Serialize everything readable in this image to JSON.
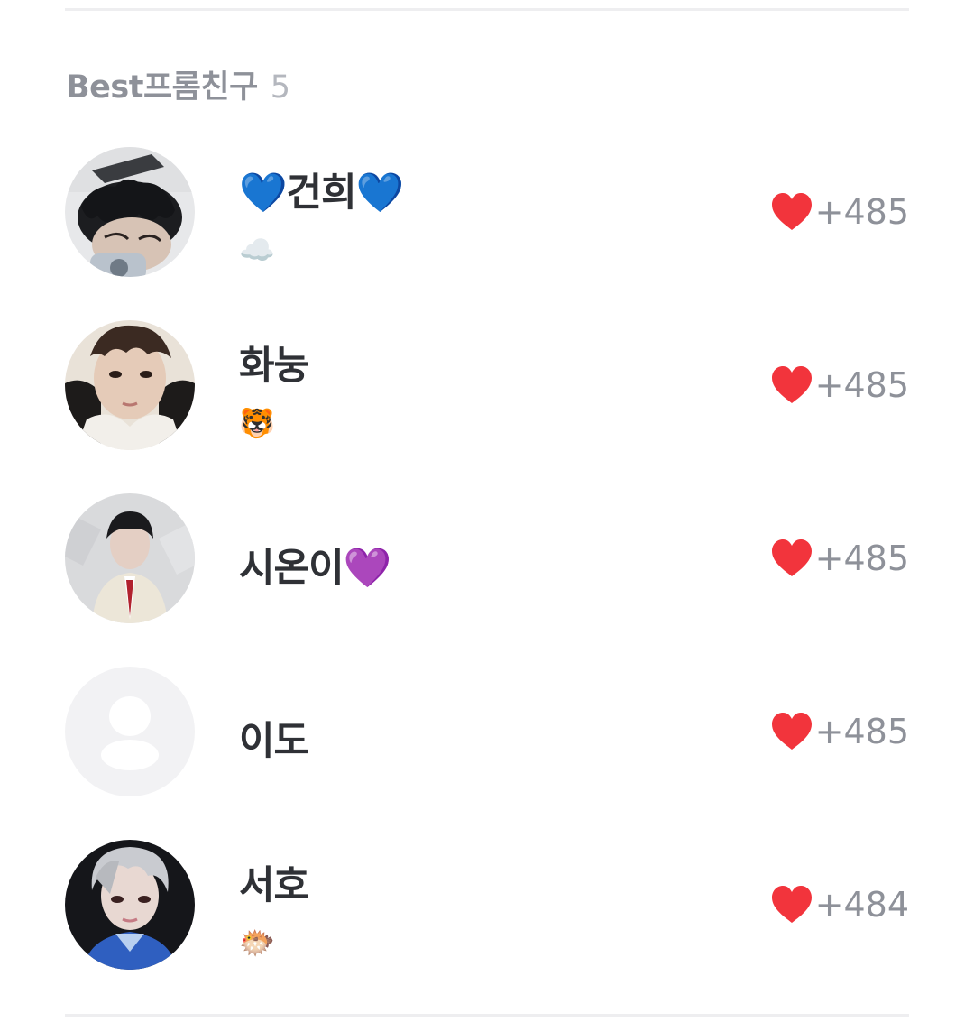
{
  "section": {
    "title": "Best프롬친구",
    "count": "5"
  },
  "friends": [
    {
      "name": "💙건희💙",
      "status": "☁️",
      "likes": "+485",
      "avatar": "photo"
    },
    {
      "name": "화눙",
      "status": "🐯",
      "likes": "+485",
      "avatar": "photo"
    },
    {
      "name": "시온이💜",
      "status": "",
      "likes": "+485",
      "avatar": "photo"
    },
    {
      "name": "이도",
      "status": "",
      "likes": "+485",
      "avatar": "placeholder"
    },
    {
      "name": "서호",
      "status": "🐡",
      "likes": "+484",
      "avatar": "photo"
    }
  ],
  "icons": {
    "like": "heart-icon",
    "default_avatar": "person-placeholder-icon"
  },
  "colors": {
    "heart": "#f2343c",
    "muted_text": "#8e9199",
    "name_text": "#2f3136",
    "placeholder_bg": "#f2f2f4",
    "placeholder_fg": "#ffffff"
  }
}
